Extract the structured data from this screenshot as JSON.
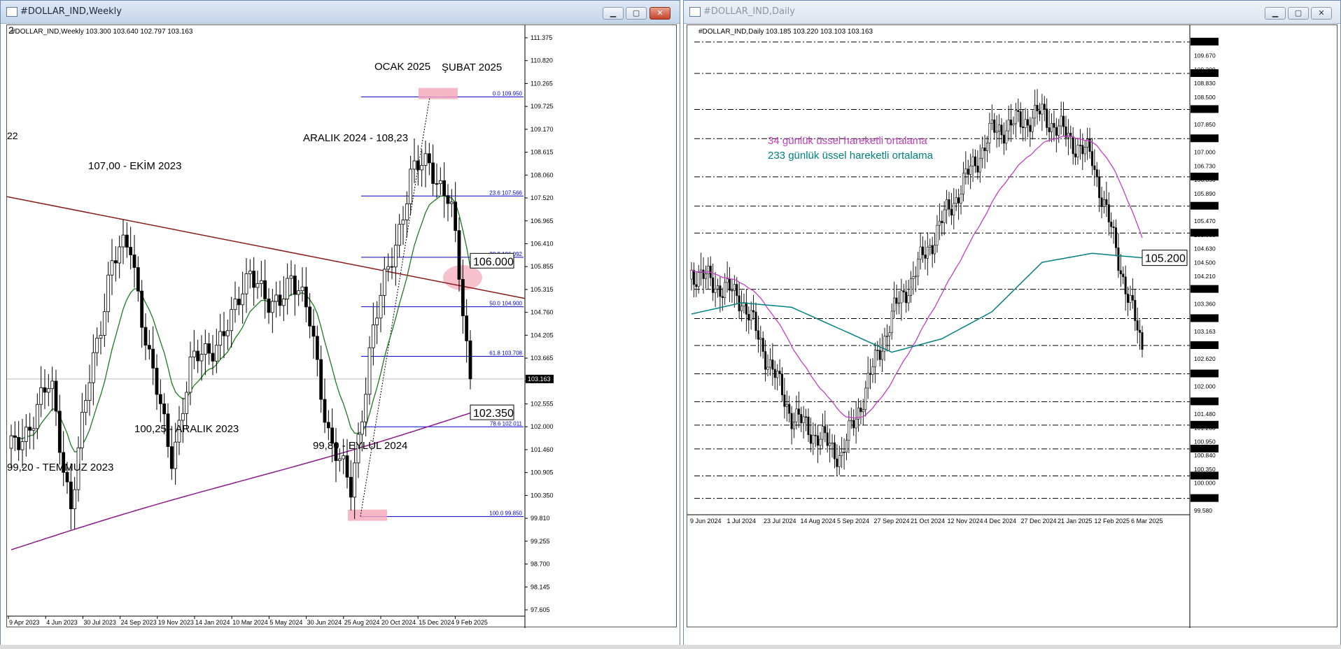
{
  "windows": [
    {
      "title": "#DOLLAR_IND,Weekly",
      "header": "#DOLLAR_IND,Weekly  103.300 103.640 102.797 103.163",
      "price_labels": [
        "111.375",
        "110.820",
        "110.265",
        "109.725",
        "109.170",
        "108.615",
        "108.060",
        "107.520",
        "106.965",
        "106.410",
        "105.855",
        "105.315",
        "104.760",
        "104.205",
        "103.665",
        "103.110",
        "102.555",
        "102.000",
        "101.460",
        "100.905",
        "100.350",
        "99.810",
        "99.255",
        "98.700",
        "98.145",
        "97.605"
      ],
      "date_labels": [
        "9 Apr 2023",
        "4 Jun 2023",
        "30 Jul 2023",
        "24 Sep 2023",
        "19 Nov 2023",
        "14 Jan 2024",
        "10 Mar 2024",
        "5 May 2024",
        "30 Jun 2024",
        "25 Aug 2024",
        "20 Oct 2024",
        "15 Dec 2024",
        "9 Feb 2025"
      ],
      "current_price": "103.163",
      "annotations": [
        "OCAK 2025",
        "ŞUBAT 2025",
        "ARALIK 2024 - 108,23",
        "107,00 - EKİM 2023",
        "100,25 - ARALIK 2023",
        "99,80 - EYLÜL 2024",
        "99,20 - TEMMUZ 2023",
        "22",
        "2"
      ],
      "boxed_labels": [
        "106.000",
        "102.350"
      ],
      "fib_labels": [
        "0.0 109.950",
        "23.6 107.566",
        "38.2 106.092",
        "50.0 104.900",
        "61.8 103.708",
        "78.6 102.011",
        "100.0 99.850"
      ]
    },
    {
      "title": "#DOLLAR_IND,Daily",
      "header": "#DOLLAR_IND,Daily  103.185 103.220 103.103 103.163",
      "price_labels": [
        "110.000",
        "109.670",
        "109.300",
        "108.830",
        "108.500",
        "107.990",
        "107.850",
        "107.150",
        "107.000",
        "106.730",
        "106.350",
        "105.890",
        "105.750",
        "105.470",
        "105.050",
        "104.630",
        "104.500",
        "104.210",
        "103.850",
        "103.360",
        "103.250",
        "103.163",
        "102.940",
        "102.620",
        "102.520",
        "102.000",
        "101.680",
        "101.480",
        "101.260",
        "100.950",
        "100.840",
        "100.350",
        "100.000",
        "99.850",
        "99.580"
      ],
      "date_labels": [
        "9 Jun 2024",
        "1 Jul 2024",
        "23 Jul 2024",
        "14 Aug 2024",
        "5 Sep 2024",
        "27 Sep 2024",
        "21 Oct 2024",
        "12 Nov 2024",
        "4 Dec 2024",
        "27 Dec 2024",
        "21 Jan 2025",
        "12 Feb 2025",
        "6 Mar 2025"
      ],
      "legend": [
        "34 günlük üssel hareketli ortalama",
        "233 günlük üssel hareketli ortalama"
      ],
      "boxed_label": "105.200"
    }
  ],
  "colors": {
    "accent_title": "#c4d5ea",
    "fib": "#0000cc",
    "trendline": "#8b1a1a",
    "ema_short_weekly": "#1e7a1e",
    "ema_long_weekly": "#8b1a8b",
    "ema_34_daily": "#c040c0",
    "ema_233_daily": "#008080",
    "highlight": "#f4a6b8"
  },
  "chart_data": [
    {
      "type": "candlestick",
      "symbol": "#DOLLAR_IND",
      "timeframe": "Weekly",
      "ohlc_last": {
        "open": 103.3,
        "high": 103.64,
        "low": 102.797,
        "close": 103.163
      },
      "ylim": [
        97.605,
        111.375
      ],
      "fibonacci_levels": [
        {
          "ratio": 0.0,
          "price": 109.95
        },
        {
          "ratio": 23.6,
          "price": 107.566
        },
        {
          "ratio": 38.2,
          "price": 106.092
        },
        {
          "ratio": 50.0,
          "price": 104.9
        },
        {
          "ratio": 61.8,
          "price": 103.708
        },
        {
          "ratio": 78.6,
          "price": 102.011
        },
        {
          "ratio": 100.0,
          "price": 99.85
        }
      ],
      "close_approx": [
        {
          "x": "2023-04",
          "y": 101.4
        },
        {
          "x": "2023-05",
          "y": 102.2
        },
        {
          "x": "2023-06",
          "y": 103.0
        },
        {
          "x": "2023-07",
          "y": 100.1
        },
        {
          "x": "2023-08",
          "y": 103.4
        },
        {
          "x": "2023-09",
          "y": 105.9
        },
        {
          "x": "2023-10",
          "y": 106.4
        },
        {
          "x": "2023-11",
          "y": 103.4
        },
        {
          "x": "2023-12",
          "y": 101.3
        },
        {
          "x": "2024-01",
          "y": 103.4
        },
        {
          "x": "2024-02",
          "y": 104.0
        },
        {
          "x": "2024-03",
          "y": 104.4
        },
        {
          "x": "2024-04",
          "y": 106.0
        },
        {
          "x": "2024-05",
          "y": 104.6
        },
        {
          "x": "2024-06",
          "y": 105.8
        },
        {
          "x": "2024-07",
          "y": 104.4
        },
        {
          "x": "2024-08",
          "y": 101.7
        },
        {
          "x": "2024-09",
          "y": 100.4
        },
        {
          "x": "2024-10",
          "y": 104.0
        },
        {
          "x": "2024-11",
          "y": 106.0
        },
        {
          "x": "2024-12",
          "y": 108.0
        },
        {
          "x": "2025-01",
          "y": 108.4
        },
        {
          "x": "2025-02",
          "y": 107.4
        },
        {
          "x": "2025-03",
          "y": 103.163
        }
      ]
    },
    {
      "type": "candlestick",
      "symbol": "#DOLLAR_IND",
      "timeframe": "Daily",
      "ohlc_last": {
        "open": 103.185,
        "high": 103.22,
        "low": 103.103,
        "close": 103.163
      },
      "ylim": [
        99.58,
        110.0
      ],
      "horizontal_levels": [
        110.0,
        109.3,
        108.5,
        107.85,
        107.0,
        106.35,
        105.75,
        104.5,
        103.85,
        103.25,
        102.62,
        102.0,
        101.48,
        100.95,
        100.35,
        99.85
      ],
      "close_approx": [
        {
          "x": "2024-06",
          "y": 104.9
        },
        {
          "x": "2024-07",
          "y": 104.3
        },
        {
          "x": "2024-08",
          "y": 101.7
        },
        {
          "x": "2024-09",
          "y": 100.8
        },
        {
          "x": "2024-10",
          "y": 103.9
        },
        {
          "x": "2024-11",
          "y": 106.0
        },
        {
          "x": "2024-12",
          "y": 108.0
        },
        {
          "x": "2025-01",
          "y": 108.4
        },
        {
          "x": "2025-02",
          "y": 107.4
        },
        {
          "x": "2025-03",
          "y": 103.163
        }
      ],
      "series": [
        {
          "name": "34 günlük üssel hareketli ortalama"
        },
        {
          "name": "233 günlük üssel hareketli ortalama"
        }
      ]
    }
  ]
}
